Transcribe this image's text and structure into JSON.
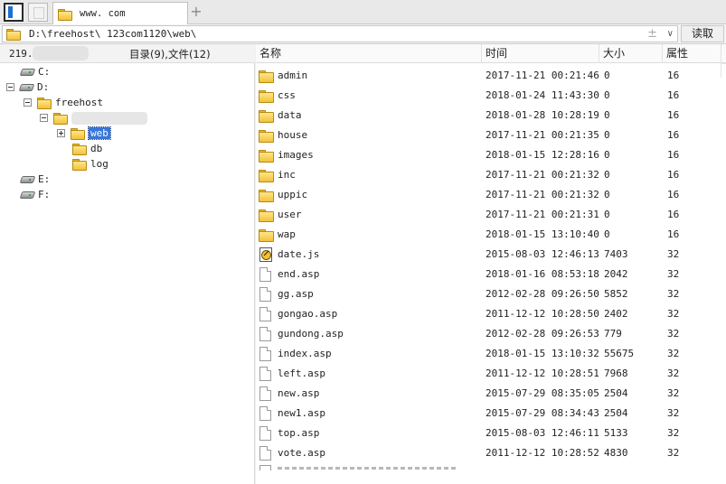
{
  "tabs": [
    {
      "label": "www.         com"
    }
  ],
  "toolbar": {
    "new_tab_symbol": "+"
  },
  "path": {
    "value": "D:\\freehost\\    123com1120\\web\\",
    "extra_symbol": "±",
    "dropdown_symbol": "∨",
    "read_label": "读取"
  },
  "left": {
    "host": "219.",
    "counts": "目录(9),文件(12)",
    "tree": {
      "c_drive": "C:",
      "d_drive": "D:",
      "freehost": "freehost",
      "web": "web",
      "db": "db",
      "log": "log",
      "e_drive": "E:",
      "f_drive": "F:"
    }
  },
  "columns": {
    "name": "名称",
    "time": "时间",
    "size": "大小",
    "attr": "属性"
  },
  "files": [
    {
      "name": "admin",
      "time": "2017-11-21 00:21:46",
      "size": "0",
      "attr": "16",
      "icon": "folder-icon"
    },
    {
      "name": "css",
      "time": "2018-01-24 11:43:30",
      "size": "0",
      "attr": "16",
      "icon": "folder-icon"
    },
    {
      "name": "data",
      "time": "2018-01-28 10:28:19",
      "size": "0",
      "attr": "16",
      "icon": "folder-icon"
    },
    {
      "name": "house",
      "time": "2017-11-21 00:21:35",
      "size": "0",
      "attr": "16",
      "icon": "folder-icon"
    },
    {
      "name": "images",
      "time": "2018-01-15 12:28:16",
      "size": "0",
      "attr": "16",
      "icon": "folder-icon"
    },
    {
      "name": "inc",
      "time": "2017-11-21 00:21:32",
      "size": "0",
      "attr": "16",
      "icon": "folder-icon"
    },
    {
      "name": "uppic",
      "time": "2017-11-21 00:21:32",
      "size": "0",
      "attr": "16",
      "icon": "folder-icon"
    },
    {
      "name": "user",
      "time": "2017-11-21 00:21:31",
      "size": "0",
      "attr": "16",
      "icon": "folder-icon"
    },
    {
      "name": "wap",
      "time": "2018-01-15 13:10:40",
      "size": "0",
      "attr": "16",
      "icon": "folder-icon"
    },
    {
      "name": "date.js",
      "time": "2015-08-03 12:46:13",
      "size": "7403",
      "attr": "32",
      "icon": "script-file-icon"
    },
    {
      "name": "end.asp",
      "time": "2018-01-16 08:53:18",
      "size": "2042",
      "attr": "32",
      "icon": "file-icon"
    },
    {
      "name": "gg.asp",
      "time": "2012-02-28 09:26:50",
      "size": "5852",
      "attr": "32",
      "icon": "file-icon"
    },
    {
      "name": "gongao.asp",
      "time": "2011-12-12 10:28:50",
      "size": "2402",
      "attr": "32",
      "icon": "file-icon"
    },
    {
      "name": "gundong.asp",
      "time": "2012-02-28 09:26:53",
      "size": "779",
      "attr": "32",
      "icon": "file-icon"
    },
    {
      "name": "index.asp",
      "time": "2018-01-15 13:10:32",
      "size": "55675",
      "attr": "32",
      "icon": "file-icon"
    },
    {
      "name": "left.asp",
      "time": "2011-12-12 10:28:51",
      "size": "7968",
      "attr": "32",
      "icon": "file-icon"
    },
    {
      "name": "new.asp",
      "time": "2015-07-29 08:35:05",
      "size": "2504",
      "attr": "32",
      "icon": "file-icon"
    },
    {
      "name": "new1.asp",
      "time": "2015-07-29 08:34:43",
      "size": "2504",
      "attr": "32",
      "icon": "file-icon"
    },
    {
      "name": "top.asp",
      "time": "2015-08-03 12:46:11",
      "size": "5133",
      "attr": "32",
      "icon": "file-icon"
    },
    {
      "name": "vote.asp",
      "time": "2011-12-12 10:28:52",
      "size": "4830",
      "attr": "32",
      "icon": "file-icon"
    }
  ],
  "colors": {
    "selection": "#3875d7",
    "folder": "#f2c23a"
  }
}
